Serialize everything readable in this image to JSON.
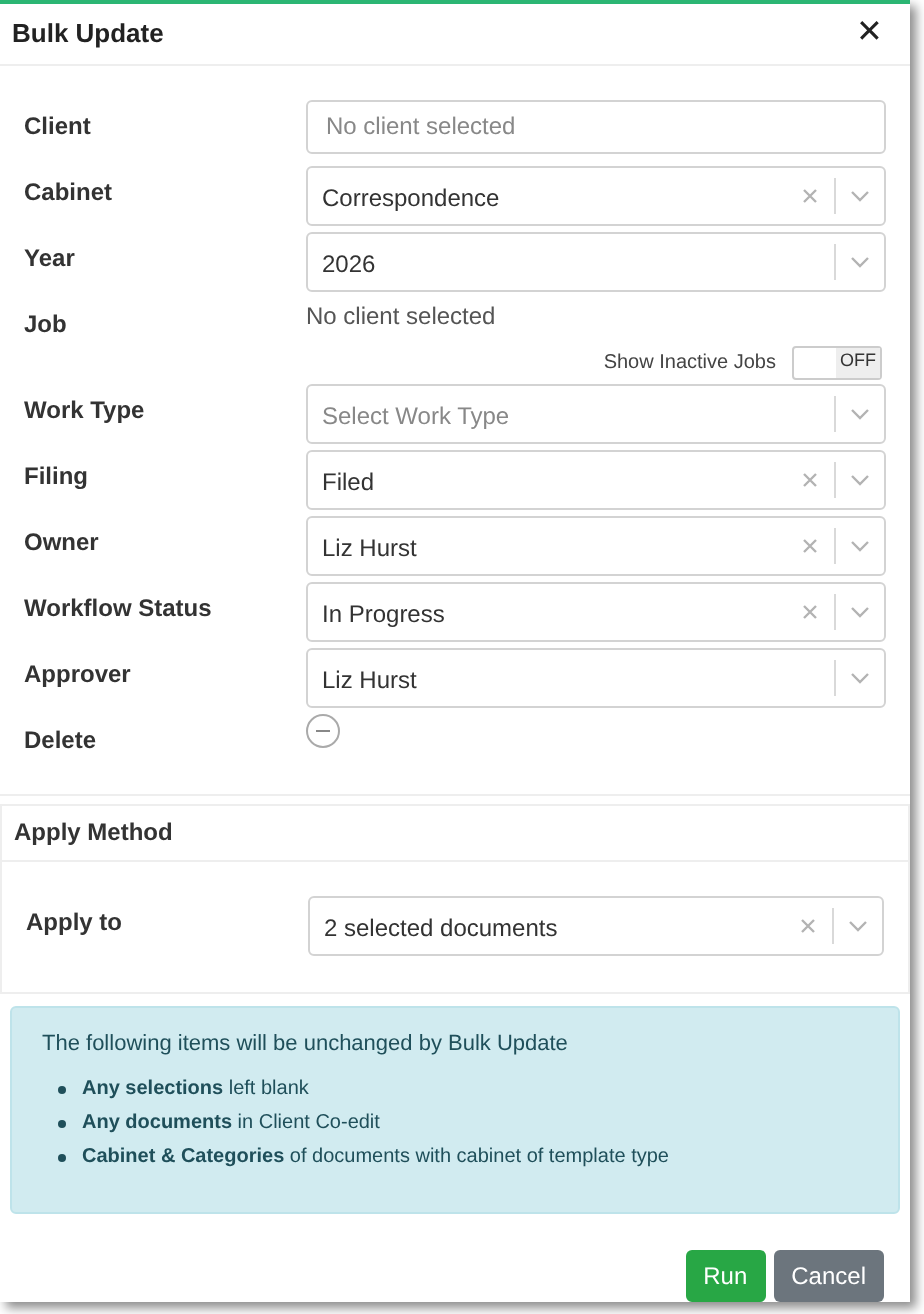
{
  "dialog": {
    "title": "Bulk Update",
    "close": "✕"
  },
  "fields": [
    {
      "kind": "input",
      "label": "Client",
      "placeholder": "No client selected"
    },
    {
      "kind": "select",
      "label": "Cabinet",
      "value": "Correspondence",
      "clearable": true
    },
    {
      "kind": "select",
      "label": "Year",
      "value": "2026",
      "clearable": false
    },
    {
      "kind": "text",
      "label": "Job",
      "value": "No client selected"
    },
    {
      "kind": "toggle",
      "label": "Show Inactive Jobs",
      "on": false,
      "state_label": "OFF"
    },
    {
      "kind": "select",
      "label": "Work Type",
      "placeholder": "Select Work Type",
      "clearable": false
    },
    {
      "kind": "select",
      "label": "Filing",
      "value": "Filed",
      "clearable": true
    },
    {
      "kind": "select",
      "label": "Owner",
      "value": "Liz Hurst",
      "clearable": true
    },
    {
      "kind": "select",
      "label": "Workflow Status",
      "value": "In Progress",
      "clearable": true
    },
    {
      "kind": "select",
      "label": "Approver",
      "value": "Liz Hurst",
      "clearable": false
    },
    {
      "kind": "remove",
      "label": "Delete"
    }
  ],
  "apply_method": {
    "title": "Apply Method",
    "fields": [
      {
        "kind": "select",
        "label": "Apply to",
        "value": "2 selected documents",
        "clearable": true
      }
    ]
  },
  "note": {
    "heading": "The following items will be unchanged by Bulk Update",
    "items": [
      "**Any selections** left blank",
      "**Any documents** in Client Co-edit",
      "**Cabinet & Categories** of documents with cabinet of template type"
    ]
  },
  "buttons": [
    {
      "label": "Run",
      "kind": "primary"
    },
    {
      "label": "Cancel",
      "kind": "secondary"
    }
  ]
}
